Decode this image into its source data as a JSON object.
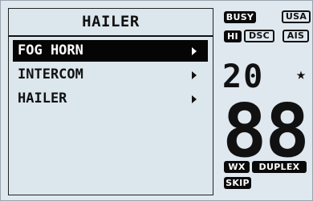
{
  "menu": {
    "title": "HAILER",
    "items": [
      {
        "label": "FOG HORN",
        "selected": true
      },
      {
        "label": "INTERCOM",
        "selected": false
      },
      {
        "label": "HAILER",
        "selected": false
      }
    ]
  },
  "status": {
    "busy": "BUSY",
    "region": "USA",
    "hi": "HI",
    "dsc": "DSC",
    "ais": "AIS",
    "channel_small": "20",
    "channel_big": "88",
    "wx": "WX",
    "duplex": "DUPLEX",
    "skip": "SKIP",
    "star": "★"
  }
}
